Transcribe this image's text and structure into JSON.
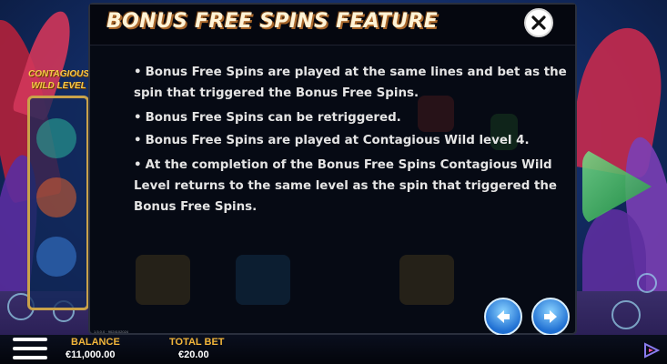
{
  "modal": {
    "title": "BONUS FREE SPINS FEATURE",
    "rules": [
      "Bonus Free Spins are played at the same lines and bet as the spin that triggered the Bonus Free Spins.",
      "Bonus Free Spins can be retriggered.",
      "Bonus Free Spins are played at Contagious Wild level 4.",
      "At the completion of the Bonus Free Spins Contagious Wild Level returns to the same level as the spin that triggered the Bonus Free Spins."
    ],
    "bullet": "•",
    "version": "1.5.0.0 · 9024102024"
  },
  "side_panel": {
    "title": "CONTAGIOUS WILD LEVEL"
  },
  "footer": {
    "balance_label": "BALANCE",
    "balance_value": "€11,000.00",
    "total_bet_label": "TOTAL BET",
    "total_bet_value": "€20.00"
  },
  "icons": {
    "close": "close-icon",
    "prev": "arrow-left-icon",
    "next": "arrow-right-icon",
    "menu": "hamburger-menu-icon",
    "play": "spin-play-icon",
    "logo": "provider-logo-icon"
  },
  "colors": {
    "accent_gold": "#f2b53a",
    "nav_blue": "#1f6fd2",
    "modal_bg": "#060a14",
    "spin_green": "#1f9a3e"
  }
}
